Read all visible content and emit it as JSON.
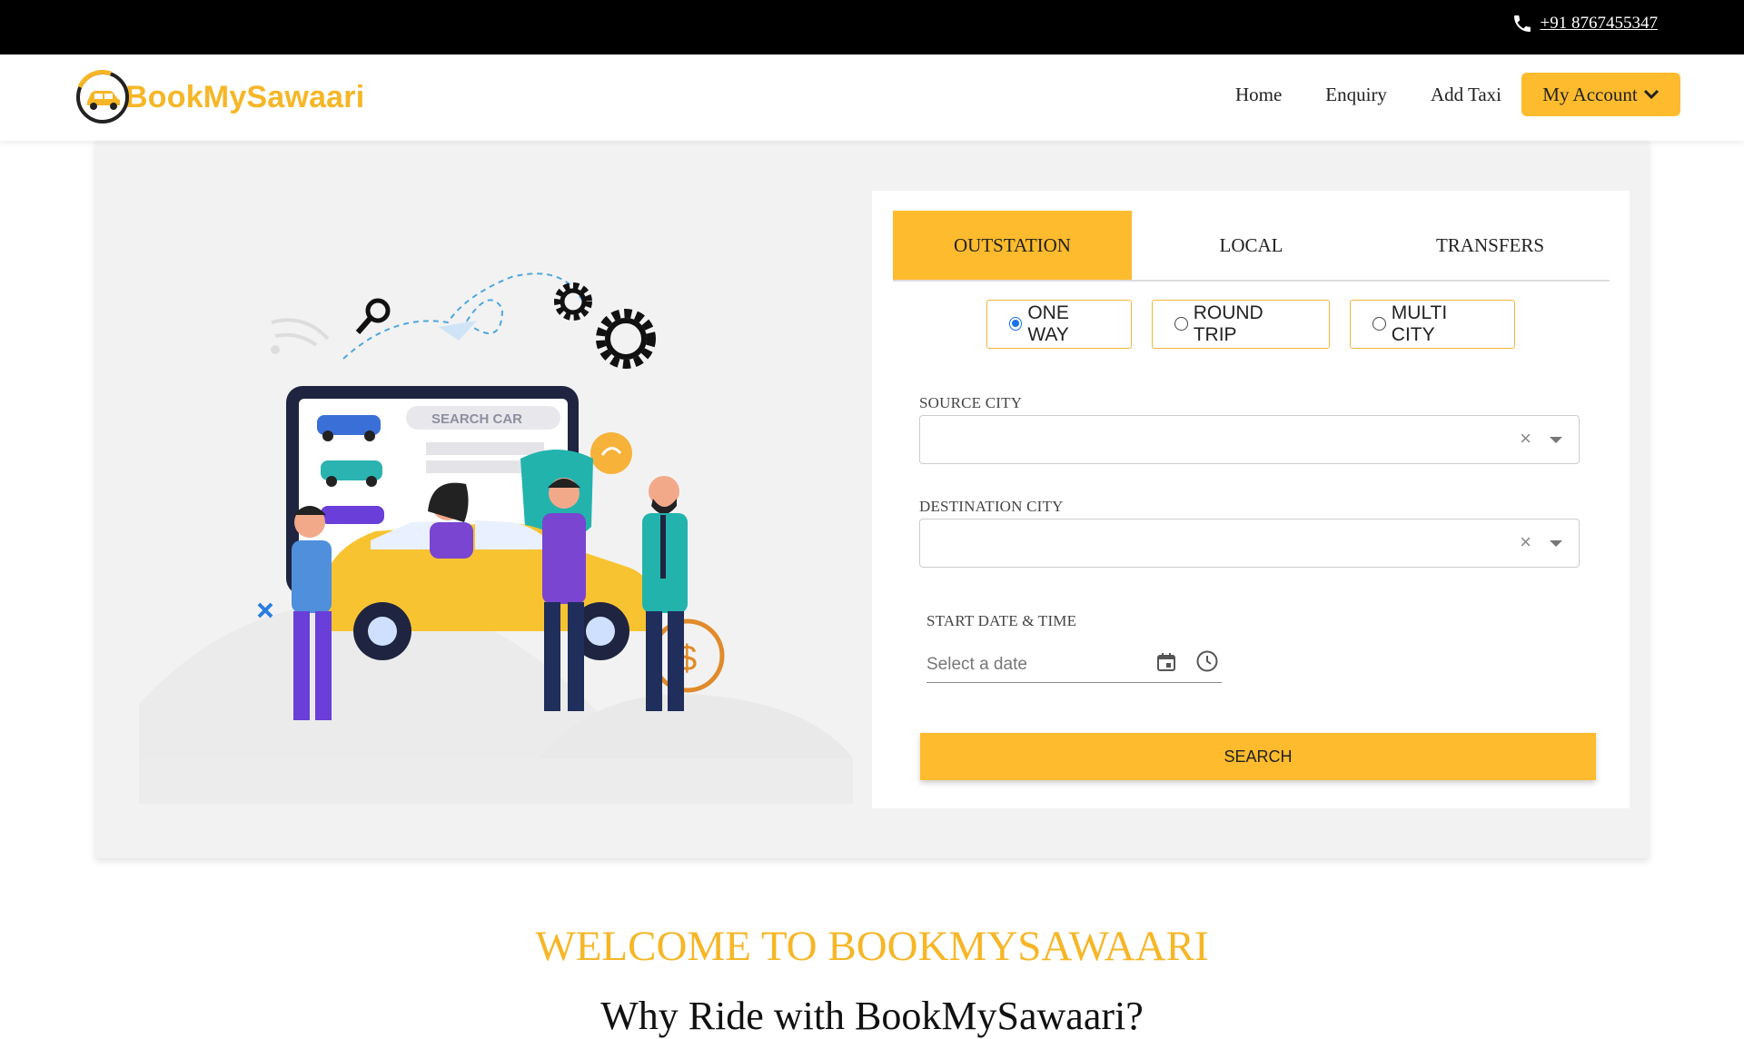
{
  "topbar": {
    "phone": "+91 8767455347",
    "phone_icon": "phone-icon"
  },
  "brand": {
    "name": "BookMySawaari",
    "color": "#f6b626"
  },
  "nav": {
    "links": [
      "Home",
      "Enquiry",
      "Add Taxi"
    ],
    "account_label": "My Account",
    "accent": "#fdbb2d"
  },
  "illustration": {
    "screen_text": "SEARCH CAR"
  },
  "booking": {
    "tabs": [
      "OUTSTATION",
      "LOCAL",
      "TRANSFERS"
    ],
    "active_tab": "OUTSTATION",
    "trip_types": [
      "ONE WAY",
      "ROUND TRIP",
      "MULTI CITY"
    ],
    "selected_trip": "ONE WAY",
    "source_label": "SOURCE CITY",
    "destination_label": "DESTINATION CITY",
    "clear_symbol": "×",
    "date_label": "START DATE & TIME",
    "date_placeholder": "Select a date",
    "search_label": "SEARCH"
  },
  "welcome": {
    "heading": "WELCOME TO BOOKMYSAWAARI",
    "subheading": "Why Ride with BookMySawaari?"
  }
}
